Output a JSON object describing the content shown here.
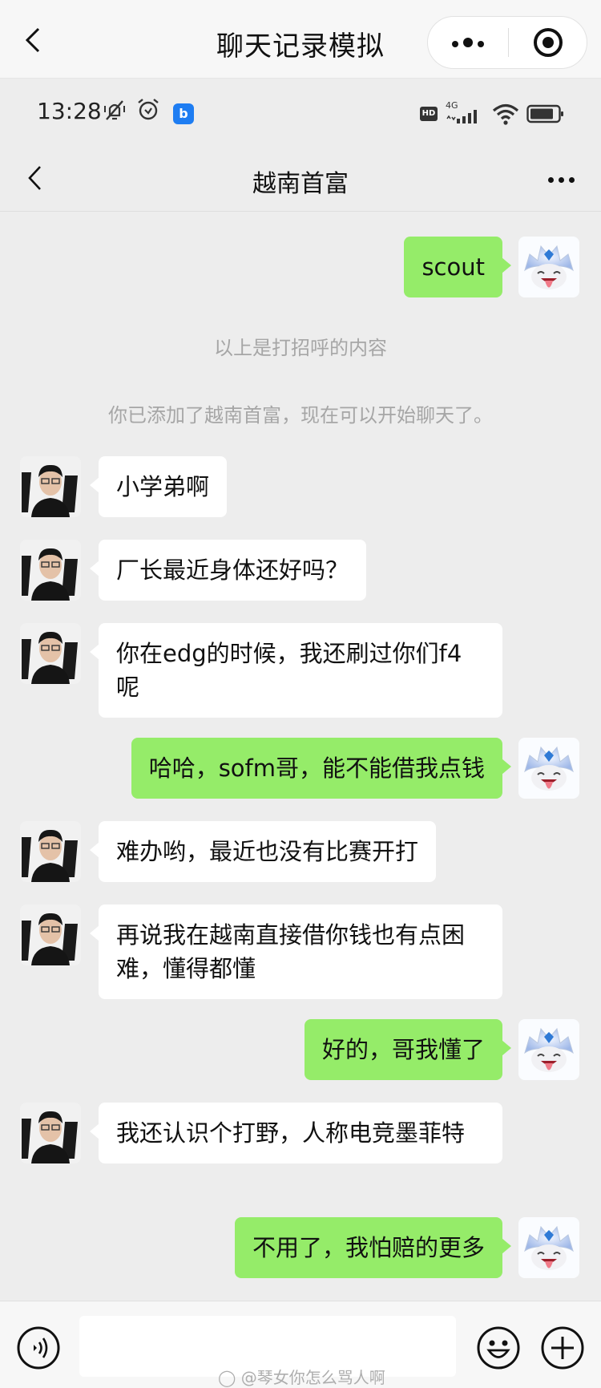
{
  "mini_program": {
    "title": "聊天记录模拟",
    "more_icon": "more-dots-icon",
    "close_icon": "target-close-icon"
  },
  "status_bar": {
    "time": "13:28",
    "icons": [
      "vibrate-mute-icon",
      "alarm-icon",
      "app-notification-icon"
    ],
    "app_badge_glyph": "b",
    "hd_label": "HD",
    "network_label": "4G",
    "right_icons": [
      "hd-icon",
      "signal-4g-icon",
      "wifi-icon",
      "battery-icon"
    ]
  },
  "chat": {
    "title": "越南首富",
    "back_icon": "chevron-left-icon",
    "more_icon": "more-dots-icon"
  },
  "colors": {
    "background": "#ededed",
    "outgoing_bubble": "#95ec69",
    "incoming_bubble": "#ffffff",
    "system_text": "#a6a6a6"
  },
  "system_messages": [
    "以上是打招呼的内容",
    "你已添加了越南首富，现在可以开始聊天了。"
  ],
  "messages": [
    {
      "side": "out",
      "sender": "me",
      "text": "scout"
    },
    {
      "side": "in",
      "sender": "越南首富",
      "text": "小学弟啊"
    },
    {
      "side": "in",
      "sender": "越南首富",
      "text": "厂长最近身体还好吗？"
    },
    {
      "side": "in",
      "sender": "越南首富",
      "text": "你在edg的时候，我还刷过你们f4呢"
    },
    {
      "side": "out",
      "sender": "me",
      "text": "哈哈，sofm哥，能不能借我点钱"
    },
    {
      "side": "in",
      "sender": "越南首富",
      "text": "难办哟，最近也没有比赛开打"
    },
    {
      "side": "in",
      "sender": "越南首富",
      "text": "再说我在越南直接借你钱也有点困难，懂得都懂"
    },
    {
      "side": "out",
      "sender": "me",
      "text": "好的，哥我懂了"
    },
    {
      "side": "in",
      "sender": "越南首富",
      "text": "我还认识个打野，人称电竞墨菲特"
    },
    {
      "side": "out",
      "sender": "me",
      "text": "不用了，我怕赔的更多"
    }
  ],
  "input_bar": {
    "voice_icon": "voice-icon",
    "input_value": "",
    "emoji_icon": "emoji-smile-icon",
    "plus_icon": "plus-circle-icon"
  },
  "watermark": "@琴女你怎么骂人啊"
}
